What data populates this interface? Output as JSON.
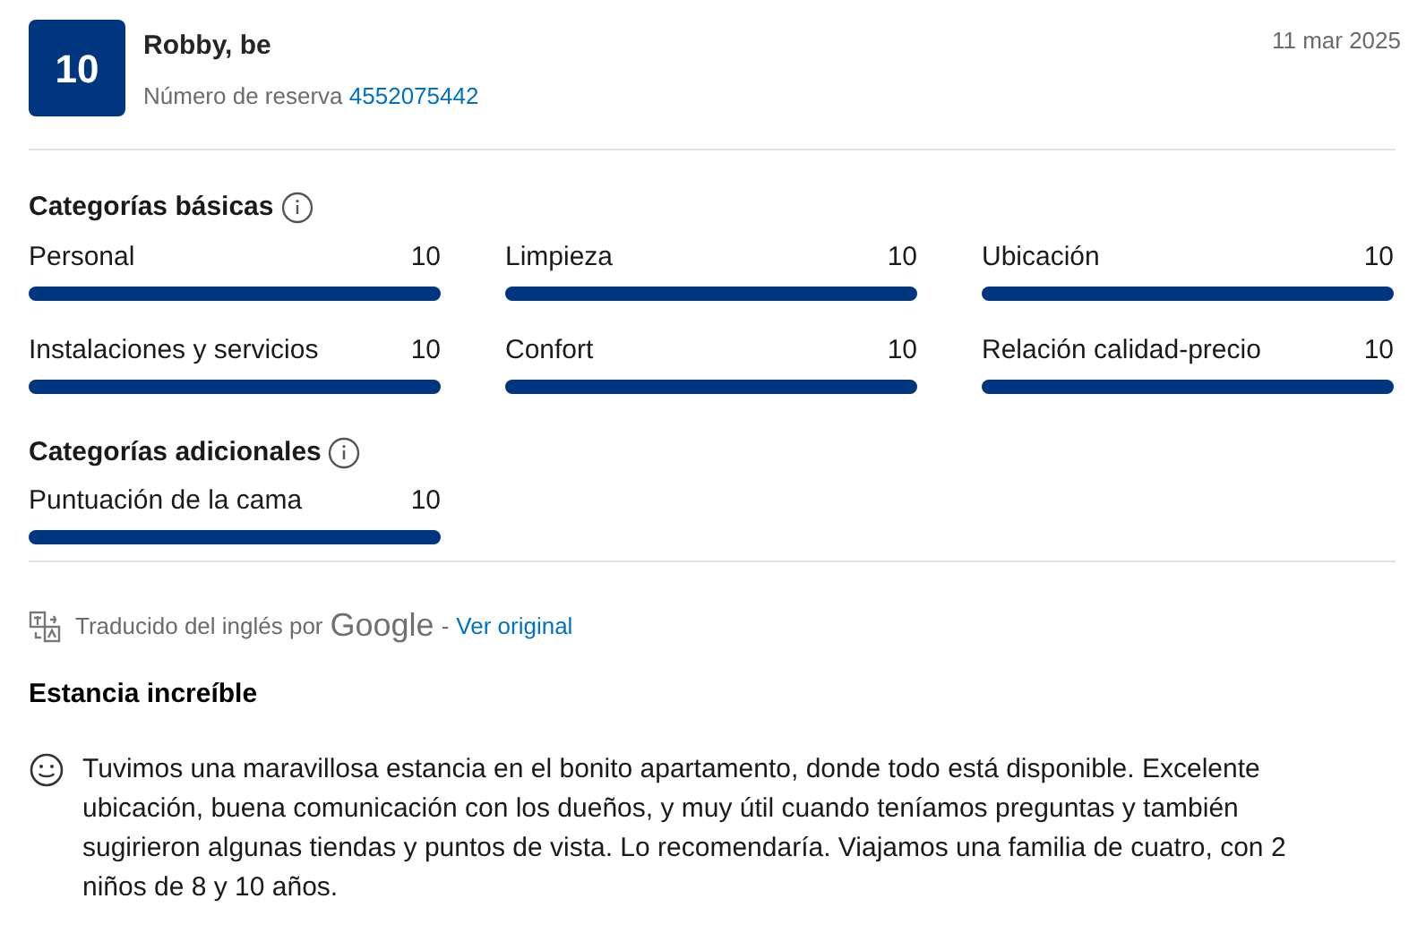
{
  "header": {
    "score": "10",
    "name": "Robby, be",
    "booking_label": "Número de reserva",
    "booking_number": "4552075442",
    "date": "11 mar 2025"
  },
  "basic": {
    "title": "Categorías básicas",
    "items": [
      {
        "label": "Personal",
        "score": "10",
        "level": 1
      },
      {
        "label": "Limpieza",
        "score": "10",
        "level": 1
      },
      {
        "label": "Ubicación",
        "score": "10",
        "level": 1
      },
      {
        "label": "Instalaciones y servicios",
        "score": "10",
        "level": 1
      },
      {
        "label": "Confort",
        "score": "10",
        "level": 1
      },
      {
        "label": "Relación calidad-precio",
        "score": "10",
        "level": 1
      }
    ]
  },
  "additional": {
    "title": "Categorías adicionales",
    "items": [
      {
        "label": "Puntuación de la cama",
        "score": "10",
        "level": 1
      }
    ]
  },
  "translation": {
    "text": "Traducido del inglés por",
    "provider": "Google",
    "separator": "-",
    "link": "Ver original"
  },
  "review": {
    "title": "Estancia increíble",
    "body": "Tuvimos una maravillosa estancia en el bonito apartamento, donde todo está disponible. Excelente ubicación, buena comunicación con los dueños, y muy útil cuando teníamos preguntas y también sugirieron algunas tiendas y puntos de vista. Lo recomendaría. Viajamos una familia de cuatro, con 2 niños de 8 y 10 años."
  }
}
